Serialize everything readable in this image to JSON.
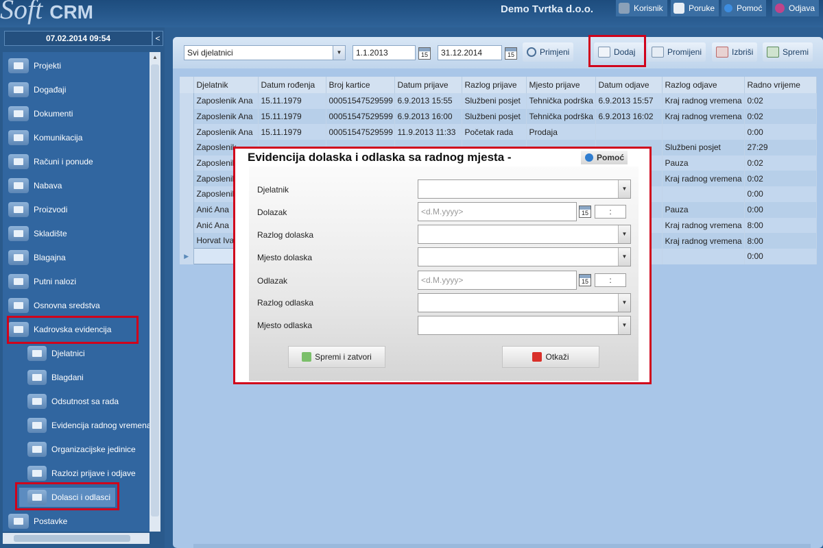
{
  "app": {
    "logo_script": "Soft",
    "logo_bold": "CRM",
    "company": "Demo Tvrtka d.o.o."
  },
  "header_buttons": [
    {
      "label": "Korisnik",
      "icon": "user-icon"
    },
    {
      "label": "Poruke",
      "icon": "message-icon"
    },
    {
      "label": "Pomoć",
      "icon": "info-icon"
    },
    {
      "label": "Odjava",
      "icon": "power-icon"
    }
  ],
  "sidebar": {
    "datetime": "07.02.2014 09:54",
    "collapse_label": "<",
    "items": [
      {
        "label": "Projekti",
        "icon": "projects-icon"
      },
      {
        "label": "Događaji",
        "icon": "calendar-icon"
      },
      {
        "label": "Dokumenti",
        "icon": "documents-icon"
      },
      {
        "label": "Komunikacija",
        "icon": "phone-icon"
      },
      {
        "label": "Računi i ponude",
        "icon": "invoice-icon"
      },
      {
        "label": "Nabava",
        "icon": "cart-icon"
      },
      {
        "label": "Proizvodi",
        "icon": "box-icon"
      },
      {
        "label": "Skladište",
        "icon": "warehouse-icon"
      },
      {
        "label": "Blagajna",
        "icon": "coins-icon"
      },
      {
        "label": "Putni nalozi",
        "icon": "travel-icon"
      },
      {
        "label": "Osnovna sredstva",
        "icon": "assets-icon"
      },
      {
        "label": "Kadrovska evidencija",
        "icon": "people-icon"
      }
    ],
    "subitems": [
      {
        "label": "Djelatnici",
        "icon": "person-icon"
      },
      {
        "label": "Blagdani",
        "icon": "calendar-icon"
      },
      {
        "label": "Odsutnost sa rada",
        "icon": "sun-icon"
      },
      {
        "label": "Evidencija radnog vremena",
        "icon": "clock-person-icon"
      },
      {
        "label": "Organizacijske jedinice",
        "icon": "org-icon"
      },
      {
        "label": "Razlozi prijave i odjave",
        "icon": "reasons-icon"
      },
      {
        "label": "Dolasci i odlasci",
        "icon": "arrivals-icon"
      }
    ],
    "footer_item": {
      "label": "Postavke",
      "icon": "tools-icon"
    }
  },
  "toolbar": {
    "employee_filter": "Svi djelatnici",
    "date_from": "1.1.2013",
    "date_to": "31.12.2014",
    "calendar_day": "15",
    "apply_label": "Primjeni",
    "add_label": "Dodaj",
    "edit_label": "Promijeni",
    "delete_label": "Izbriši",
    "save_label": "Spremi"
  },
  "grid": {
    "columns": [
      "Djelatnik",
      "Datum rođenja",
      "Broj kartice",
      "Datum prijave",
      "Razlog prijave",
      "Mjesto prijave",
      "Datum odjave",
      "Razlog odjave",
      "Radno vrijeme"
    ],
    "rows": [
      [
        "Zaposlenik Ana",
        "15.11.1979",
        "00051547529599",
        "6.9.2013 15:55",
        "Službeni posjet",
        "Tehnička podrška",
        "6.9.2013 15:57",
        "Kraj radnog vremena",
        "0:02"
      ],
      [
        "Zaposlenik Ana",
        "15.11.1979",
        "00051547529599",
        "6.9.2013 16:00",
        "Službeni posjet",
        "Tehnička podrška",
        "6.9.2013 16:02",
        "Kraj radnog vremena",
        "0:02"
      ],
      [
        "Zaposlenik Ana",
        "15.11.1979",
        "00051547529599",
        "11.9.2013 11:33",
        "Početak rada",
        "Prodaja",
        "",
        "",
        "0:00"
      ],
      [
        "Zaposlenik",
        "",
        "",
        "",
        "",
        "",
        "",
        "Službeni posjet",
        "27:29"
      ],
      [
        "Zaposlenik",
        "",
        "",
        "",
        "",
        "",
        "",
        "Pauza",
        "0:02"
      ],
      [
        "Zaposlenik",
        "",
        "",
        "",
        "",
        "",
        "",
        "Kraj radnog vremena",
        "0:02"
      ],
      [
        "Zaposlenik",
        "",
        "",
        "",
        "",
        "",
        "",
        "",
        "0:00"
      ],
      [
        "Anić Ana",
        "",
        "",
        "",
        "",
        "",
        "",
        "Pauza",
        "0:00"
      ],
      [
        "Anić Ana",
        "",
        "",
        "",
        "",
        "",
        "",
        "Kraj radnog vremena",
        "8:00"
      ],
      [
        "Horvat Iva",
        "",
        "",
        "",
        "",
        "",
        "",
        "Kraj radnog vremena",
        "8:00"
      ],
      [
        "",
        "",
        "",
        "",
        "",
        "",
        "",
        "",
        "0:00"
      ]
    ]
  },
  "dialog": {
    "title": "Evidencija dolaska i odlaska sa radnog mjesta -",
    "help_label": "Pomoć",
    "fields": {
      "employee_label": "Djelatnik",
      "arrival_label": "Dolazak",
      "arrival_reason_label": "Razlog dolaska",
      "arrival_place_label": "Mjesto dolaska",
      "departure_label": "Odlazak",
      "departure_reason_label": "Razlog odlaska",
      "departure_place_label": "Mjesto odlaska"
    },
    "date_placeholder": "<d.M.yyyy>",
    "time_separator": ":",
    "save_close_label": "Spremi i zatvori",
    "cancel_label": "Otkaži"
  }
}
